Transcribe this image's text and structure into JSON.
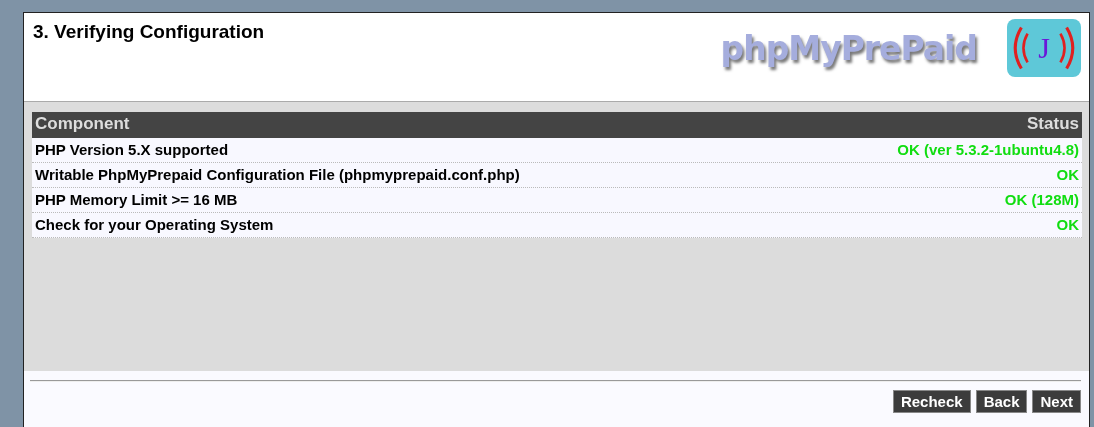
{
  "title": "3. Verifying Configuration",
  "logo": {
    "wordmark": "phpMyPrePaid",
    "badge": "J"
  },
  "table": {
    "columns": [
      "Component",
      "Status"
    ],
    "rows": [
      {
        "component": "PHP Version 5.X supported",
        "status": "OK (ver 5.3.2-1ubuntu4.8)",
        "ok": true
      },
      {
        "component": "Writable PhpMyPrepaid Configuration File (phpmyprepaid.conf.php)",
        "status": "OK",
        "ok": true
      },
      {
        "component": "PHP Memory Limit >= 16 MB",
        "status": "OK (128M)",
        "ok": true
      },
      {
        "component": "Check for your Operating System",
        "status": "OK",
        "ok": true
      }
    ]
  },
  "buttons": [
    "Recheck",
    "Back",
    "Next"
  ]
}
